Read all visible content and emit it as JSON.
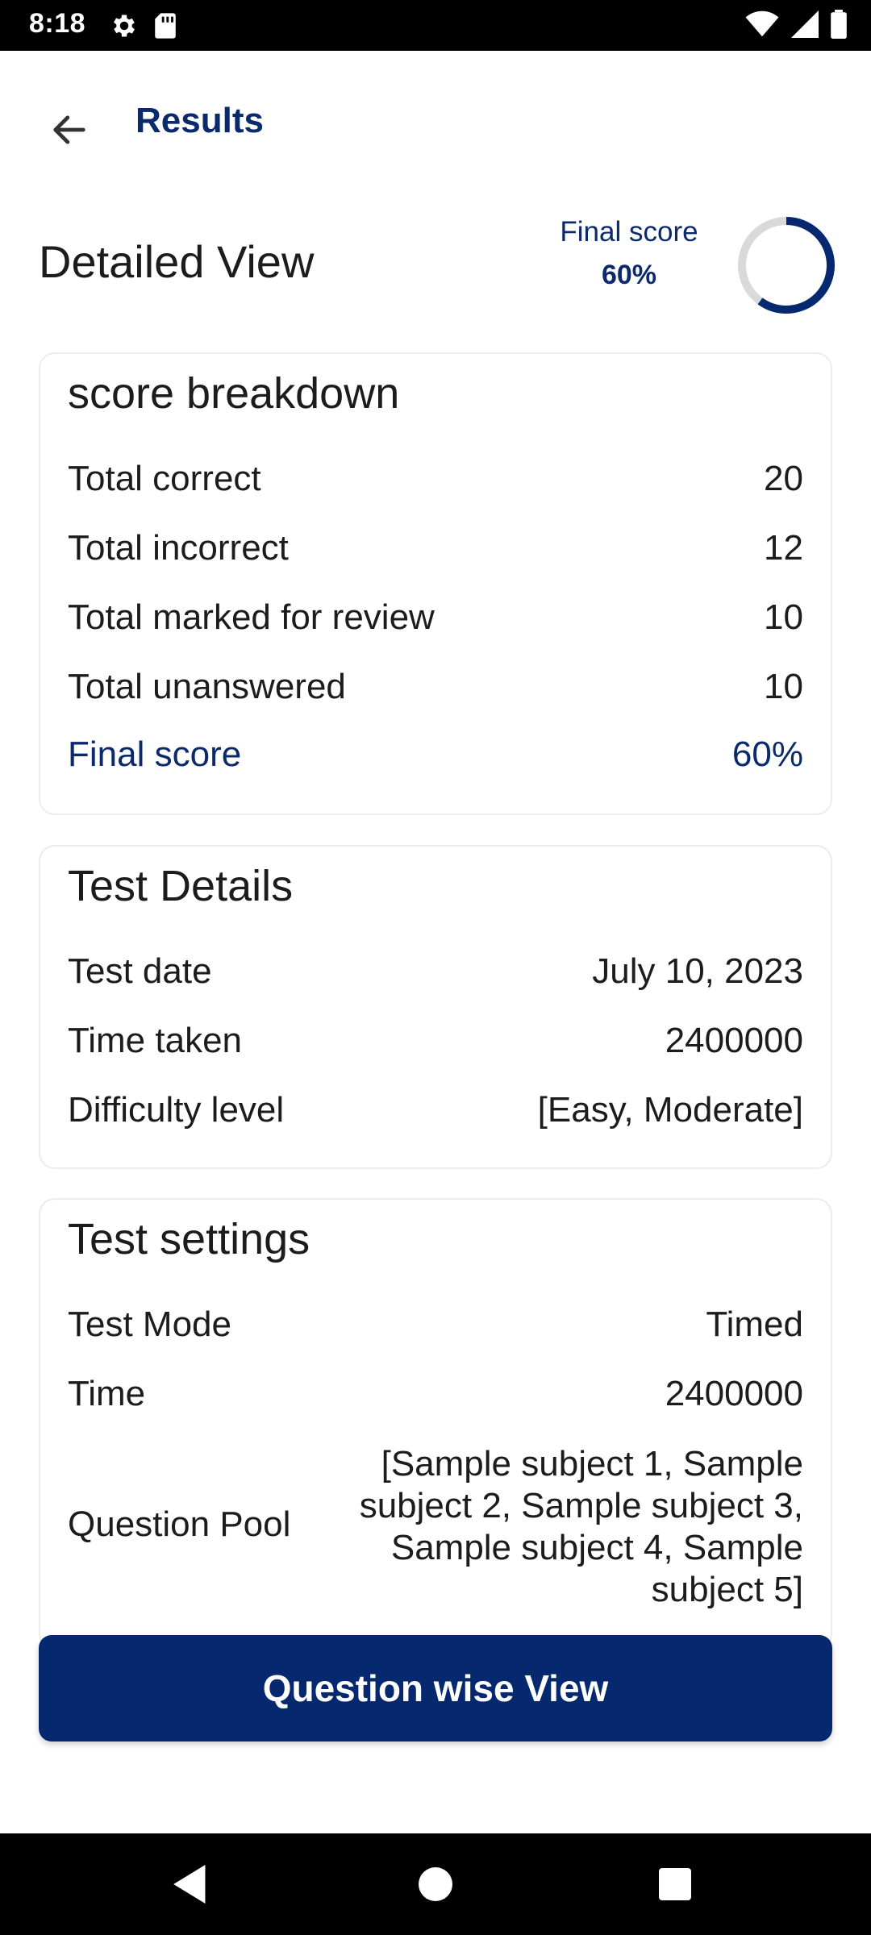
{
  "status_bar": {
    "time": "8:18"
  },
  "app_bar": {
    "title": "Results"
  },
  "header": {
    "title": "Detailed View",
    "final_score_label": "Final score",
    "final_score_value": "60%",
    "score_fraction": 0.6
  },
  "score_breakdown": {
    "title": "score breakdown",
    "rows": [
      {
        "label": "Total correct",
        "value": "20"
      },
      {
        "label": "Total incorrect",
        "value": "12"
      },
      {
        "label": "Total marked for review",
        "value": "10"
      },
      {
        "label": "Total unanswered",
        "value": "10"
      },
      {
        "label": "Final score",
        "value": "60%"
      }
    ]
  },
  "test_details": {
    "title": "Test Details",
    "rows": [
      {
        "label": "Test date",
        "value": "July 10, 2023"
      },
      {
        "label": "Time taken",
        "value": "2400000"
      },
      {
        "label": "Difficulty level",
        "value": "[Easy, Moderate]"
      }
    ]
  },
  "test_settings": {
    "title": "Test settings",
    "rows": [
      {
        "label": "Test Mode",
        "value": "Timed"
      },
      {
        "label": "Time",
        "value": "2400000"
      },
      {
        "label": "Question Pool",
        "value": "[Sample subject 1, Sample subject 2, Sample subject 3, Sample subject 4, Sample subject 5]"
      }
    ]
  },
  "actions": {
    "primary_label": "Question wise View"
  },
  "colors": {
    "accent": "#0b2a6b",
    "button": "#06286e",
    "ring_track": "#d9d9d9"
  },
  "icons": [
    "settings-icon",
    "sd-card-icon",
    "wifi-icon",
    "signal-icon",
    "battery-icon",
    "back-arrow-icon",
    "nav-back-icon",
    "nav-home-icon",
    "nav-recents-icon"
  ]
}
